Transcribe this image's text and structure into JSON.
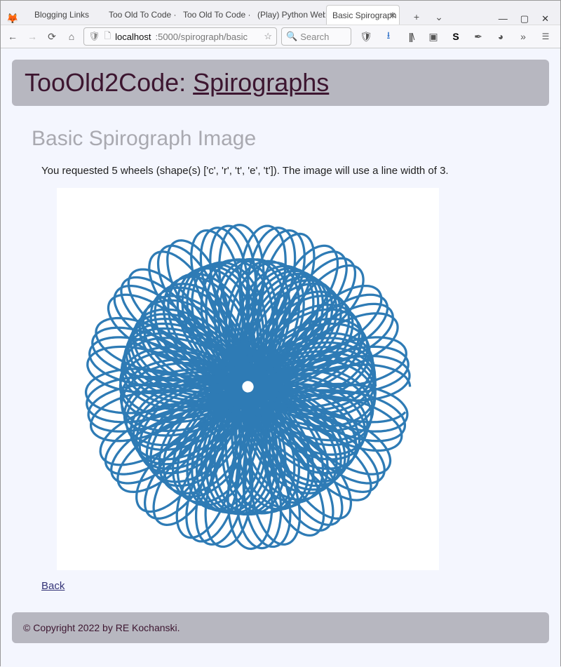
{
  "browser": {
    "tabs": [
      {
        "label": "Blogging Links",
        "active": false
      },
      {
        "label": "Too Old To Code · Ric",
        "active": false
      },
      {
        "label": "Too Old To Code · Ric",
        "active": false
      },
      {
        "label": "(Play) Python Web A",
        "active": false
      },
      {
        "label": "Basic Spirograph Im",
        "active": true
      }
    ],
    "new_tab_label": "+",
    "listall_label": "⌄",
    "win_min": "—",
    "win_max": "▢",
    "win_close": "✕",
    "url_host": "localhost",
    "url_port_path": ":5000/spirograph/basic",
    "search_placeholder": "Search"
  },
  "page": {
    "banner_prefix": "TooOld2Code: ",
    "banner_link": "Spirographs",
    "heading": "Basic Spirograph Image",
    "description": "You requested 5 wheels (shape(s) ['c', 'r', 't', 'e', 't']). The image will use a line width of 3.",
    "back_label": "Back",
    "footer": "© Copyright 2022 by RE Kochanski."
  },
  "spirograph": {
    "wheel_count": 5,
    "shapes": [
      "c",
      "r",
      "t",
      "e",
      "t"
    ],
    "line_width": 3,
    "color": "#2e7bb5"
  }
}
